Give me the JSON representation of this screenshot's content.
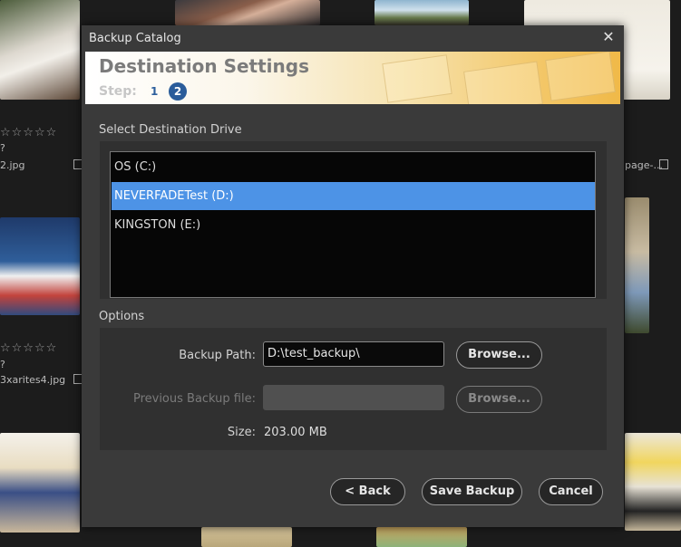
{
  "background": {
    "file_labels": [
      "2.jpg",
      "3xarites4.jpg",
      "page-..."
    ],
    "question_marks": [
      "?",
      "?"
    ],
    "star_rating": "☆☆☆☆☆"
  },
  "dialog": {
    "title": "Backup Catalog",
    "close_glyph": "✕",
    "banner": {
      "heading": "Destination Settings",
      "step_label": "Step:",
      "step_1": "1",
      "step_2": "2"
    },
    "drive_section_label": "Select Destination Drive",
    "drives": [
      {
        "label": "OS (C:)",
        "selected": false
      },
      {
        "label": "NEVERFADETest (D:)",
        "selected": true
      },
      {
        "label": "KINGSTON (E:)",
        "selected": false
      }
    ],
    "options_label": "Options",
    "backup_path_label": "Backup Path:",
    "backup_path_value": "D:\\test_backup\\",
    "browse_label": "Browse...",
    "previous_backup_label": "Previous Backup file:",
    "previous_backup_value": "",
    "size_label": "Size:",
    "size_value": "203.00 MB",
    "back_label": "< Back",
    "save_backup_label": "Save Backup",
    "cancel_label": "Cancel"
  },
  "colors": {
    "selection": "#4d93e6",
    "step_badge": "#2a5c9a",
    "dialog_bg": "#3a3a3a"
  }
}
